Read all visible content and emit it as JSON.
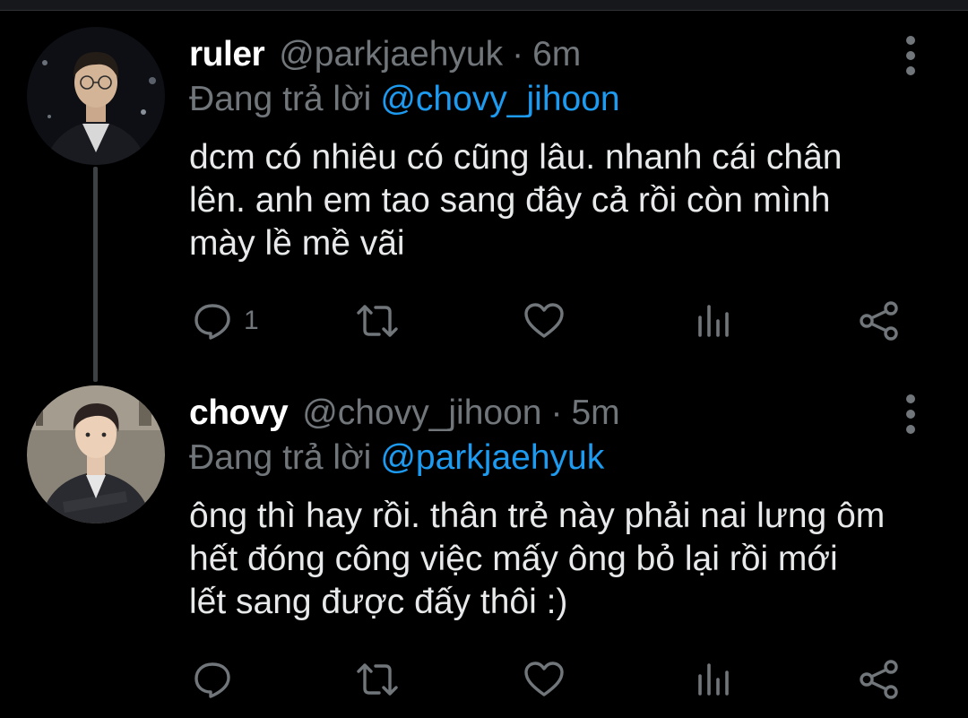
{
  "colors": {
    "background": "#000000",
    "text": "#e7e9ea",
    "muted": "#71767b",
    "accent": "#1d9bf0",
    "thread_line": "#3e4144"
  },
  "tweets": [
    {
      "display_name": "ruler",
      "handle": "@parkjaehyuk",
      "separator": "·",
      "time": "6m",
      "reply_prefix": "Đang trả lời",
      "reply_to": "@chovy_jihoon",
      "text_lines": [
        "dcm có nhiêu có cũng lâu. nhanh cái chân",
        "lên. anh em tao sang đây cả rồi còn mình",
        "mày lề mề vãi"
      ],
      "reply_count": "1",
      "icons": [
        "comment-icon",
        "retweet-icon",
        "heart-icon",
        "views-icon",
        "share-icon",
        "more-vertical-icon"
      ]
    },
    {
      "display_name": "chovy",
      "handle": "@chovy_jihoon",
      "separator": "·",
      "time": "5m",
      "reply_prefix": "Đang trả lời",
      "reply_to": "@parkjaehyuk",
      "text_lines": [
        "ông thì hay rồi. thân trẻ này phải nai lưng ôm",
        "hết đóng công việc mấy ông bỏ lại rồi mới",
        "lết sang được đấy thôi :)"
      ],
      "reply_count": "",
      "icons": [
        "comment-icon",
        "retweet-icon",
        "heart-icon",
        "views-icon",
        "share-icon",
        "more-vertical-icon"
      ]
    }
  ]
}
